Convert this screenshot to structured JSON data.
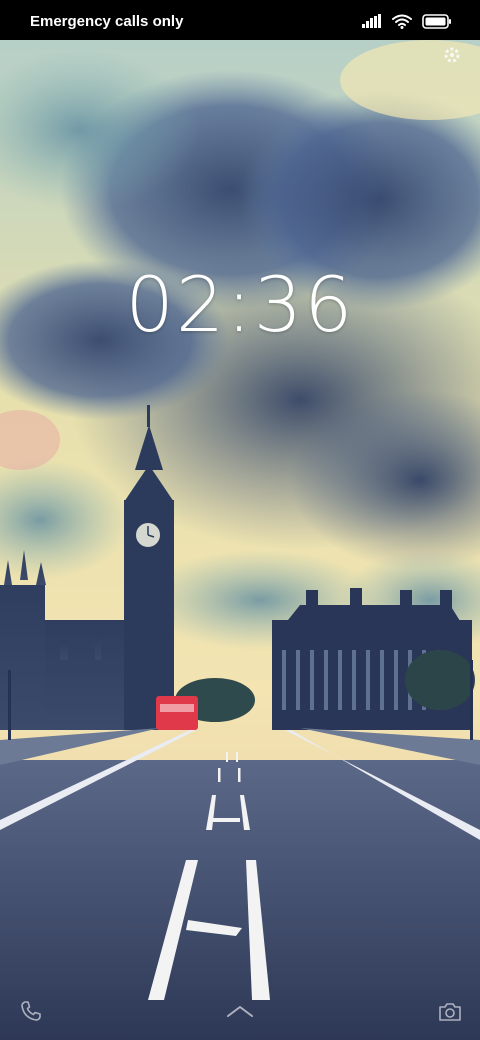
{
  "status_bar": {
    "carrier_text": "Emergency calls only",
    "signal_icon": "signal-icon",
    "wifi_icon": "wifi-icon",
    "battery_icon": "battery-icon"
  },
  "lockscreen": {
    "time": "02:36",
    "wallpaper": "london-bridge-big-ben-wallpaper",
    "settings_icon": "gear-icon",
    "shortcuts": {
      "left": "phone-icon",
      "center": "chevron-up-icon",
      "right": "camera-icon"
    }
  },
  "colors": {
    "status_bar_bg": "#000000",
    "clock_text": "#ffffff",
    "sky_top": "#3e5a86",
    "sky_glow": "#f1e7b4",
    "road": "#34405f",
    "bus_red": "#e0394a"
  }
}
